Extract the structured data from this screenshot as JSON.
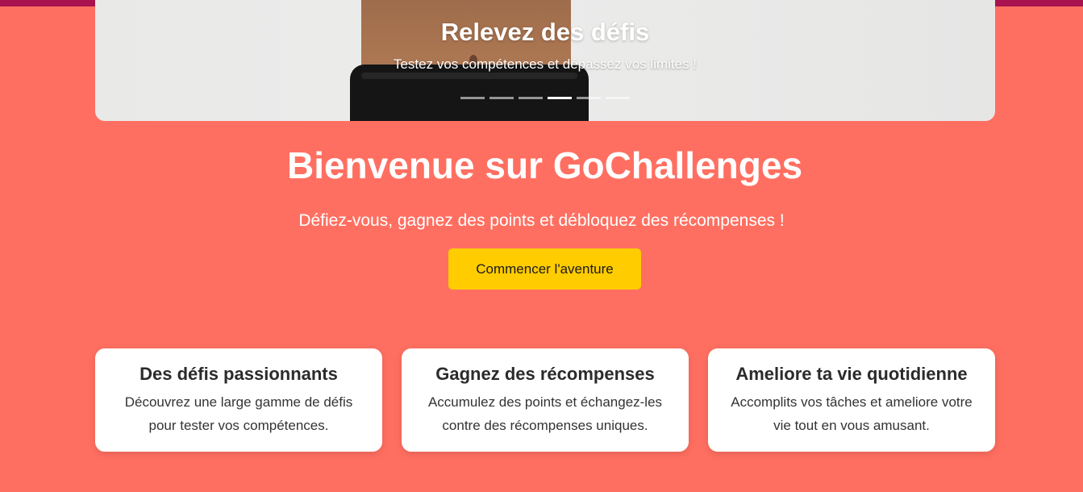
{
  "colors": {
    "background": "#ff6f61",
    "top_bar": "#a8124f",
    "cta_background": "#ffcc00",
    "card_background": "#ffffff"
  },
  "carousel": {
    "title": "Relevez des défis",
    "subtitle": "Testez vos compétences et dépassez vos limites !",
    "slide_count": 6,
    "active_index": 3
  },
  "hero": {
    "title": "Bienvenue sur GoChallenges",
    "subtitle": "Défiez-vous, gagnez des points et débloquez des récompenses !",
    "cta_label": "Commencer l'aventure"
  },
  "features": [
    {
      "title": "Des défis passionnants",
      "text": "Découvrez une large gamme de défis pour tester vos compétences."
    },
    {
      "title": "Gagnez des récompenses",
      "text": "Accumulez des points et échangez-les contre des récompenses uniques."
    },
    {
      "title": "Ameliore ta vie quotidienne",
      "text": "Accomplits vos tâches et ameliore votre vie tout en vous amusant."
    }
  ]
}
